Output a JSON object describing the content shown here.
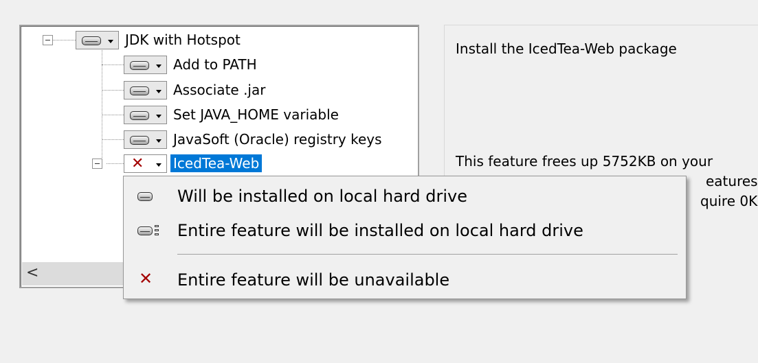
{
  "tree": {
    "items": [
      {
        "label": "JDK with Hotspot",
        "state": "install-local"
      },
      {
        "label": "Add to PATH",
        "state": "install-local"
      },
      {
        "label": "Associate .jar",
        "state": "install-local"
      },
      {
        "label": "Set JAVA_HOME variable",
        "state": "install-local"
      },
      {
        "label": "JavaSoft (Oracle) registry keys",
        "state": "install-local"
      },
      {
        "label": "IcedTea-Web",
        "state": "unavailable",
        "selected": true
      }
    ],
    "scroll_left_glyph": "<"
  },
  "description": {
    "title": "Install the IcedTea-Web package",
    "size_lines": [
      "This feature frees up 5752KB on your",
      "eatures",
      "quire 0KB"
    ]
  },
  "menu": {
    "items": [
      {
        "label": "Will be installed on local hard drive",
        "icon": "hard-drive-icon"
      },
      {
        "label": "Entire feature will be installed on local hard drive",
        "icon": "hard-drive-with-subfeatures-icon"
      },
      {
        "label": "Entire feature will be unavailable",
        "icon": "red-x-icon"
      }
    ]
  },
  "colors": {
    "selection": "#0078d7",
    "unavailable": "#a30000",
    "background": "#f0f0f0"
  }
}
